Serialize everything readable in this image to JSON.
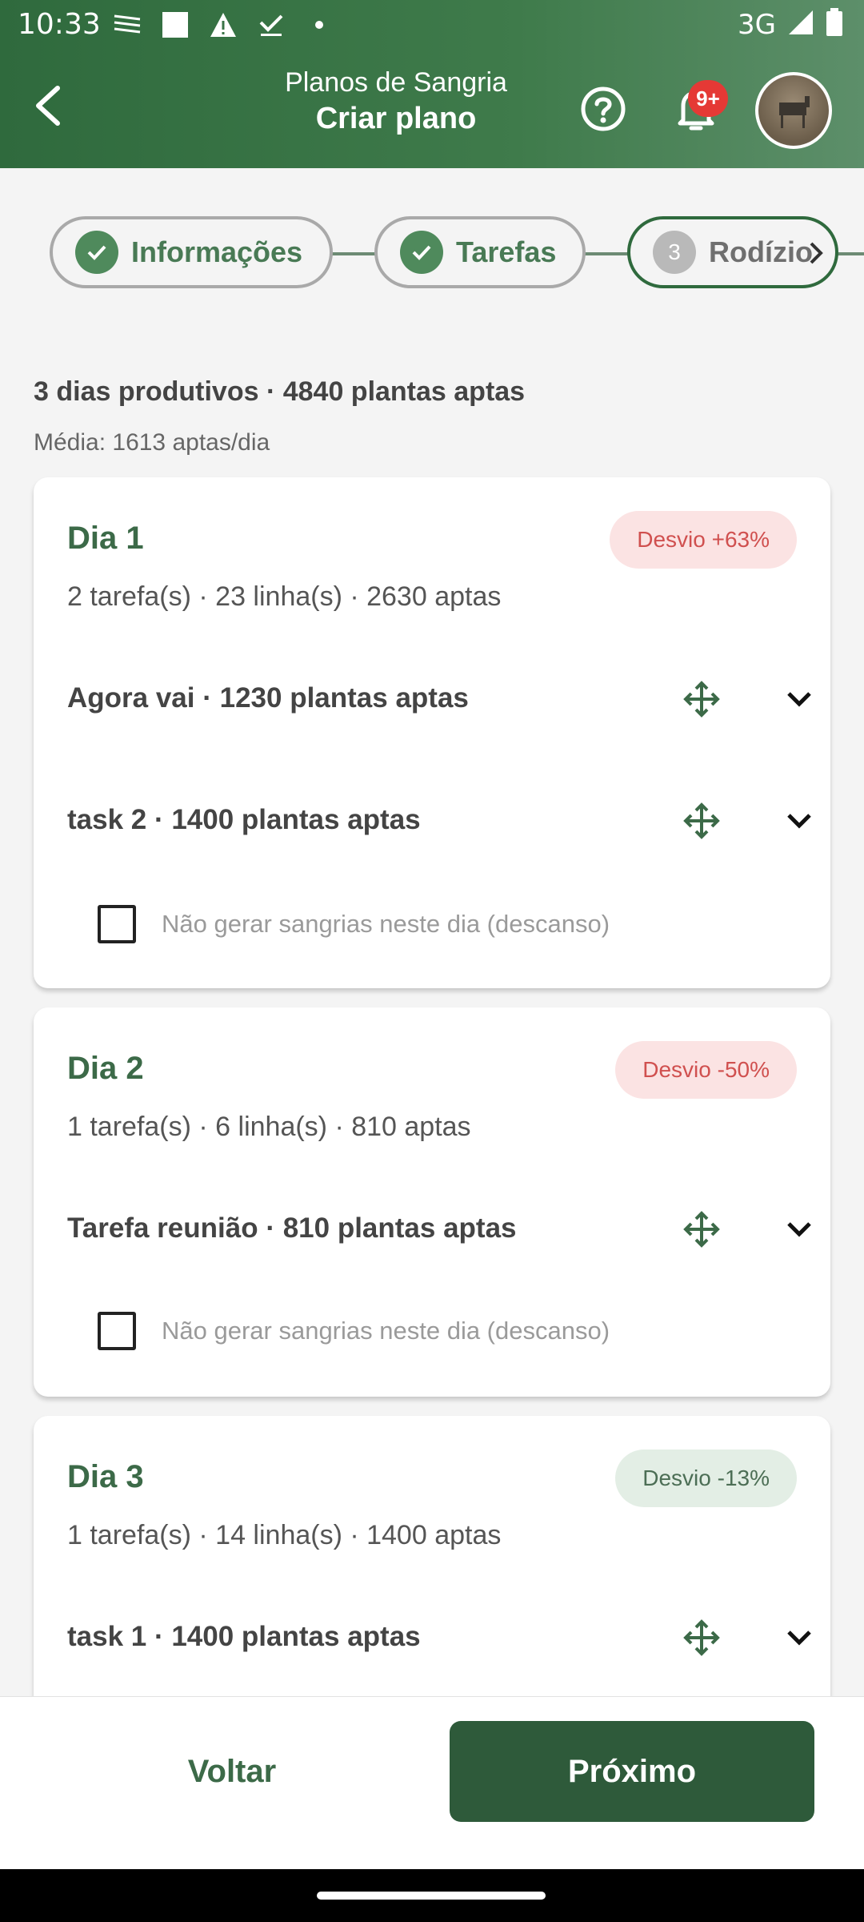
{
  "status_bar": {
    "time": "10:33",
    "network": "3G"
  },
  "header": {
    "back_icon": "arrow-back-icon",
    "supertitle": "Planos de Sangria",
    "title": "Criar plano",
    "notification_badge": "9+"
  },
  "stepper": {
    "steps": [
      {
        "label": "Informações",
        "state": "done"
      },
      {
        "label": "Tarefas",
        "state": "done"
      },
      {
        "label": "Rodízio",
        "number": "3",
        "state": "current"
      }
    ]
  },
  "summary": {
    "headline": "3 dias produtivos · 4840 plantas aptas",
    "average": "Média: 1613 aptas/dia"
  },
  "days": [
    {
      "title": "Dia 1",
      "deviation": "Desvio +63%",
      "meta": "2 tarefa(s) · 23 linha(s) · 2630 aptas",
      "tasks": [
        "Agora vai · 1230 plantas aptas",
        "task 2 · 1400 plantas aptas"
      ],
      "rest_label": "Não gerar sangrias neste dia (descanso)"
    },
    {
      "title": "Dia 2",
      "deviation": "Desvio -50%",
      "meta": "1 tarefa(s) · 6 linha(s) · 810 aptas",
      "tasks": [
        "Tarefa reunião · 810 plantas aptas"
      ],
      "rest_label": "Não gerar sangrias neste dia (descanso)"
    },
    {
      "title": "Dia 3",
      "deviation": "Desvio -13%",
      "meta": "1 tarefa(s) · 14 linha(s) · 1400 aptas",
      "tasks": [
        "task 1 · 1400 plantas aptas"
      ]
    }
  ],
  "footer": {
    "back_label": "Voltar",
    "next_label": "Próximo"
  },
  "colors": {
    "primary": "#2e5a3a",
    "accent": "#4f8a5c",
    "bad": "#d0504f",
    "good_bg": "#e3eee5"
  }
}
